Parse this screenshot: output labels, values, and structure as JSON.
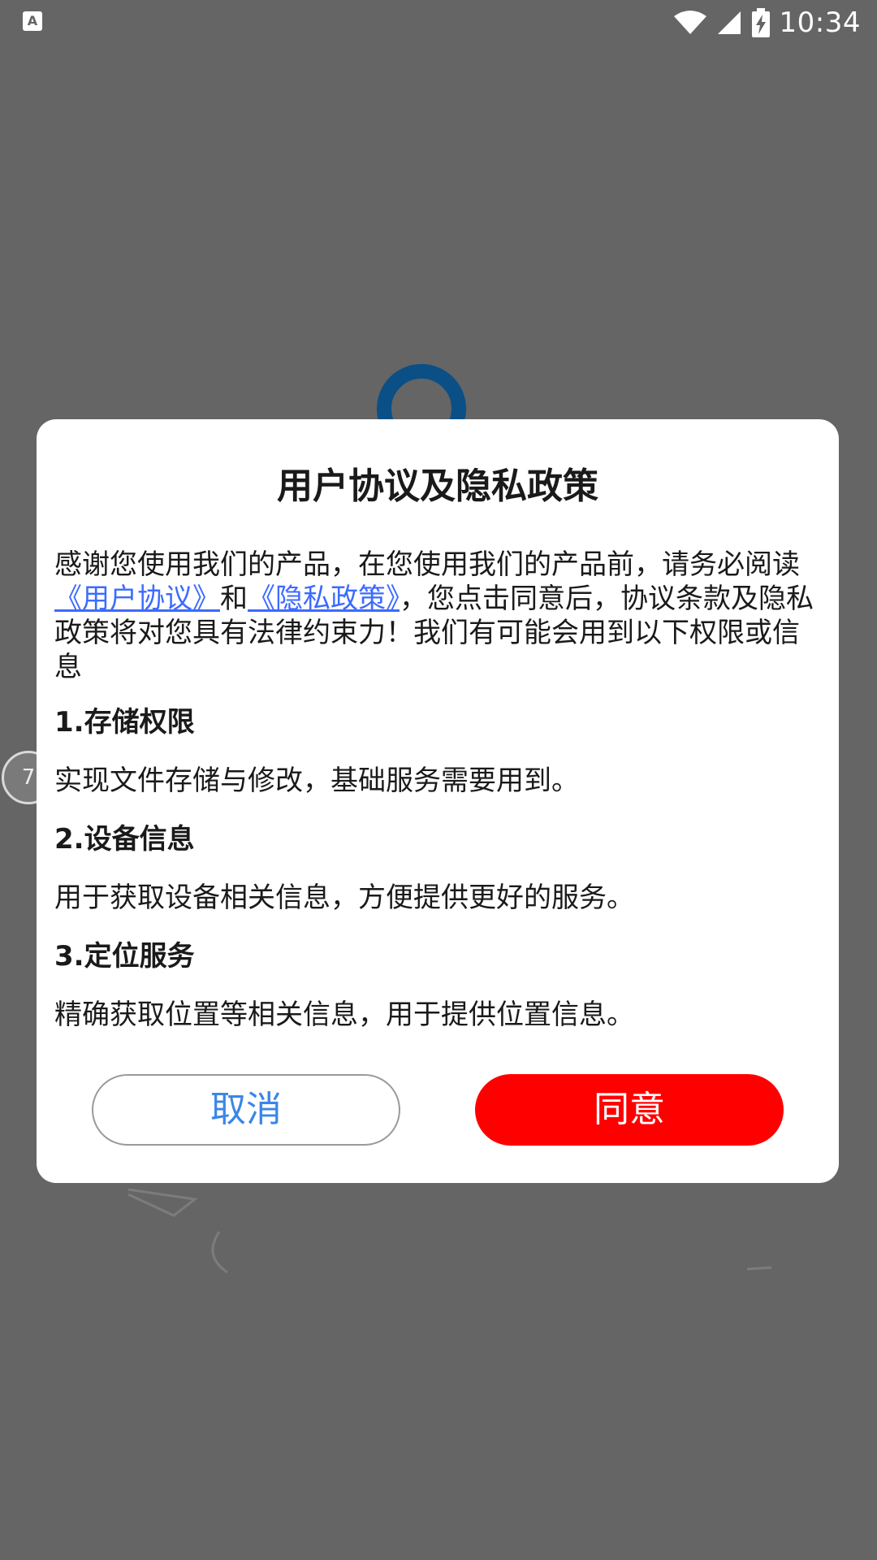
{
  "status_bar": {
    "app_icon_letter": "A",
    "time": "10:34"
  },
  "background": {
    "progress_text": "7"
  },
  "dialog": {
    "title": "用户协议及隐私政策",
    "intro_prefix": "感谢您使用我们的产品，在您使用我们的产品前，请务必阅读",
    "link_user_agreement": "《用户协议》",
    "intro_and": "和",
    "link_privacy_policy": "《隐私政策》",
    "intro_suffix": "，您点击同意后，协议条款及隐私政策将对您具有法律约束力！我们有可能会用到以下权限或信息",
    "permissions": [
      {
        "title": "1.存储权限",
        "desc": "实现文件存储与修改，基础服务需要用到。"
      },
      {
        "title": "2.设备信息",
        "desc": "用于获取设备相关信息，方便提供更好的服务。"
      },
      {
        "title": "3.定位服务",
        "desc": "精确获取位置等相关信息，用于提供位置信息。"
      }
    ],
    "cancel_label": "取消",
    "agree_label": "同意"
  },
  "colors": {
    "overlay": "#656565",
    "link": "#3c6bff",
    "agree_button": "#ff0000",
    "cancel_text": "#3a86e8"
  }
}
